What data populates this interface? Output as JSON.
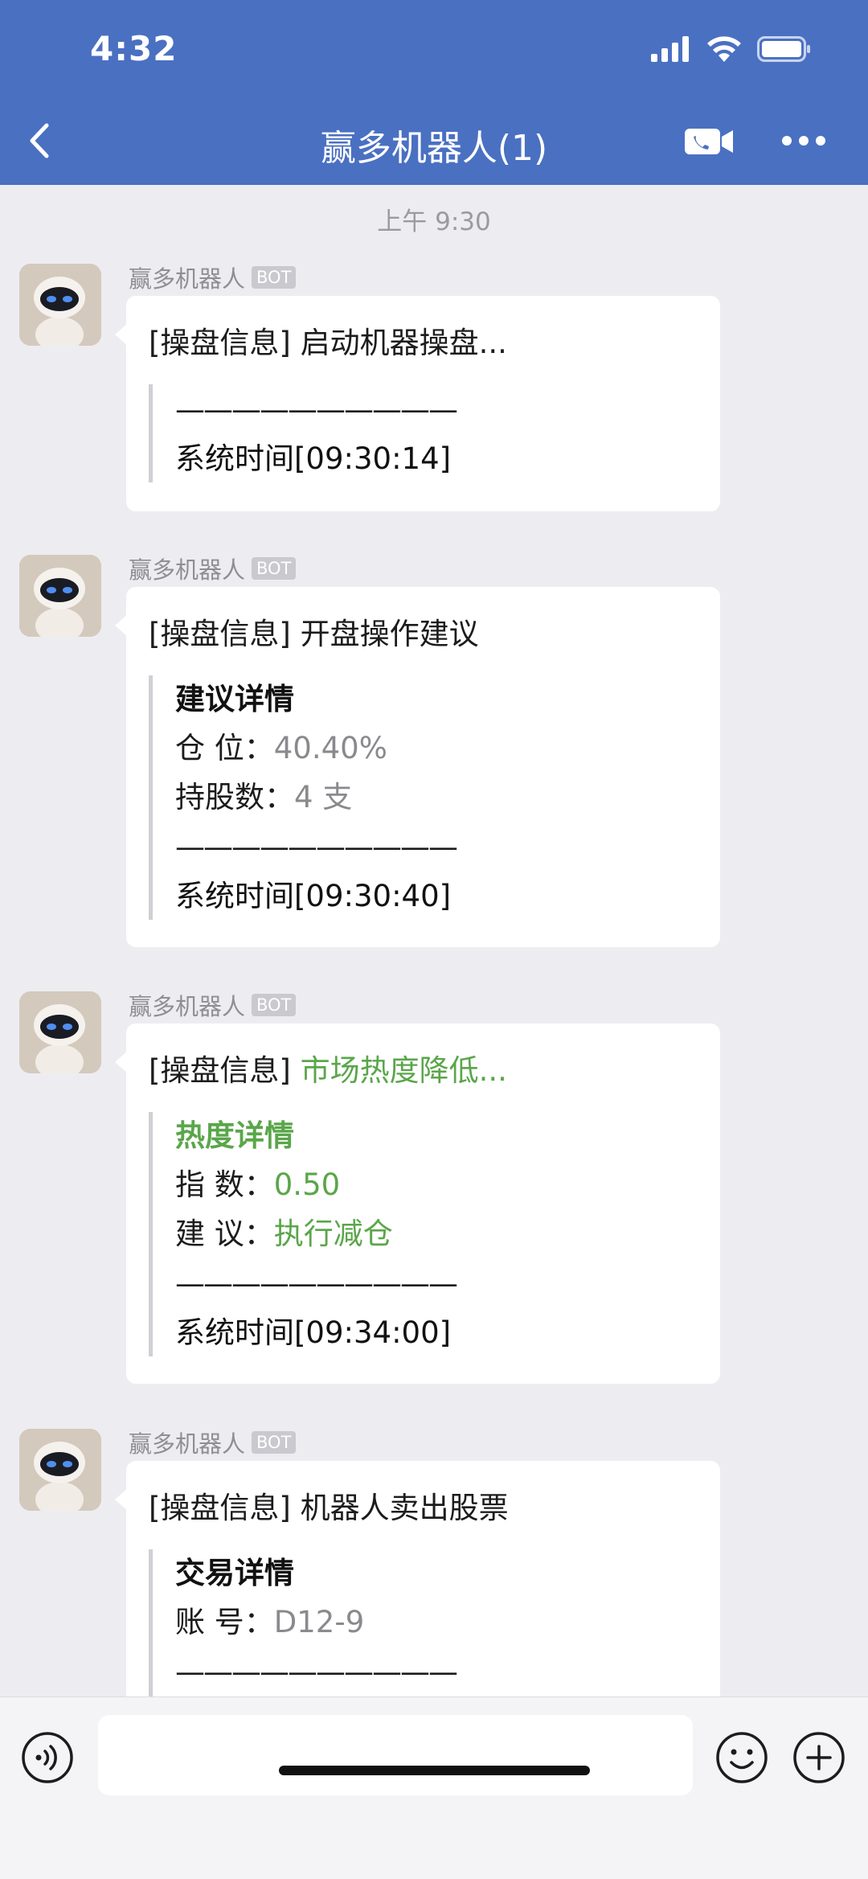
{
  "status": {
    "time": "4:32"
  },
  "header": {
    "title": "赢多机器人(1)"
  },
  "timestamp": "上午 9:30",
  "messages": [
    {
      "sender": "赢多机器人",
      "badge": "BOT",
      "prefix": "[操盘信息]",
      "headline": "启动机器操盘...",
      "separator": "——————————",
      "system_time": "系统时间[09:30:14]"
    },
    {
      "sender": "赢多机器人",
      "badge": "BOT",
      "prefix": "[操盘信息]",
      "headline": "开盘操作建议",
      "detail_title": "建议详情",
      "rows": [
        {
          "label": "仓  位：",
          "value": "40.40%"
        },
        {
          "label": "持股数：",
          "value": "4 支"
        }
      ],
      "separator": "——————————",
      "system_time": "系统时间[09:30:40]"
    },
    {
      "sender": "赢多机器人",
      "badge": "BOT",
      "prefix": "[操盘信息]",
      "headline": "市场热度降低...",
      "detail_title": "热度详情",
      "rows": [
        {
          "label": "指  数：",
          "value": "0.50"
        },
        {
          "label": "建  议：",
          "value": "执行减仓"
        }
      ],
      "separator": "——————————",
      "system_time": "系统时间[09:34:00]"
    },
    {
      "sender": "赢多机器人",
      "badge": "BOT",
      "prefix": "[操盘信息]",
      "headline": "机器人卖出股票",
      "detail_title": "交易详情",
      "rows": [
        {
          "label": "账  号：",
          "value": "D12-9"
        }
      ],
      "separator": "——————————"
    }
  ],
  "colors": {
    "header": "#4a70c2",
    "accent_green": "#5aa64a",
    "background": "#ededf1"
  },
  "icons": [
    "back-icon",
    "video-call-icon",
    "more-icon",
    "voice-icon",
    "emoji-icon",
    "add-icon",
    "signal-icon",
    "wifi-icon",
    "battery-icon"
  ]
}
